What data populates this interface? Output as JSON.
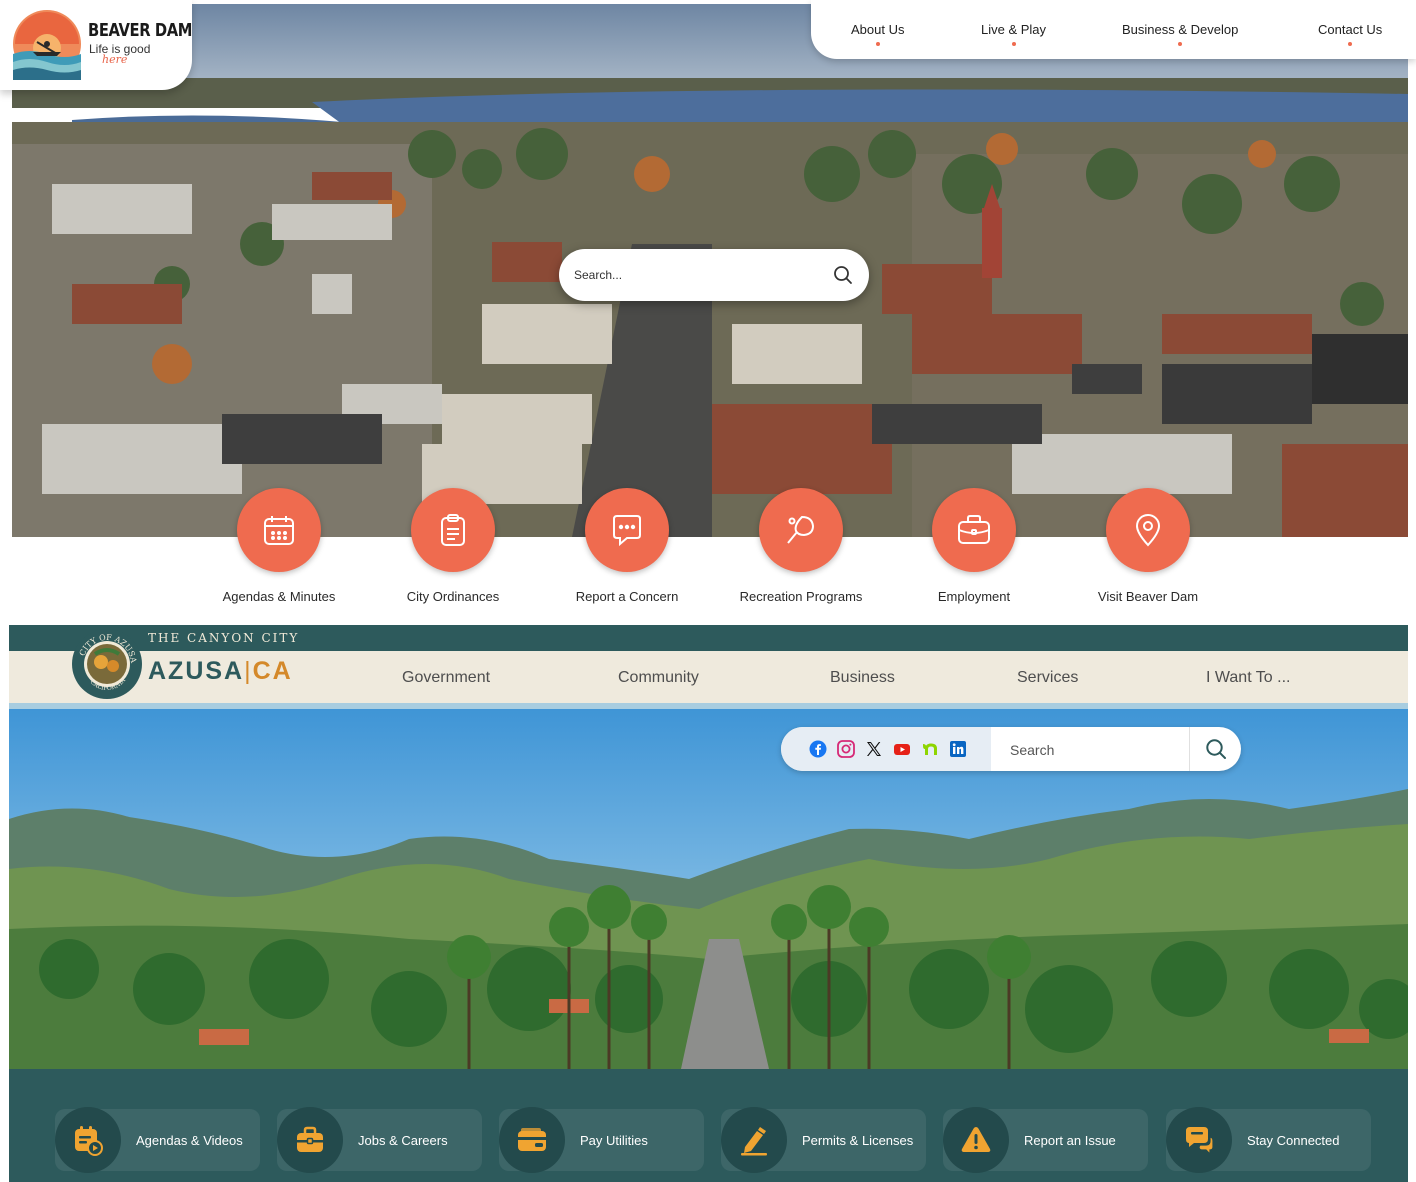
{
  "beaver_dam": {
    "logo": {
      "name": "BEAVER DAM",
      "tagline": "Life is good",
      "tagline_script": "here"
    },
    "nav": [
      {
        "label": "About Us"
      },
      {
        "label": "Live & Play"
      },
      {
        "label": "Business & Develop"
      },
      {
        "label": "Contact Us"
      }
    ],
    "search": {
      "placeholder": "Search..."
    },
    "quick_links": [
      {
        "label": "Agendas & Minutes",
        "icon": "calendar-icon"
      },
      {
        "label": "City Ordinances",
        "icon": "clipboard-icon"
      },
      {
        "label": "Report a Concern",
        "icon": "chat-bubble-icon"
      },
      {
        "label": "Recreation Programs",
        "icon": "paddle-ball-icon"
      },
      {
        "label": "Employment",
        "icon": "briefcase-icon"
      },
      {
        "label": "Visit Beaver Dam",
        "icon": "map-pin-icon"
      }
    ],
    "accent_color": "#ef6b4f"
  },
  "azusa": {
    "tagline": "THE CANYON CITY",
    "seal_text": "CITY OF AZUSA CALIFORNIA",
    "wordmark": {
      "city": "AZUSA",
      "separator": "|",
      "state": "CA"
    },
    "nav": [
      {
        "label": "Government"
      },
      {
        "label": "Community"
      },
      {
        "label": "Business"
      },
      {
        "label": "Services"
      },
      {
        "label": "I Want To ..."
      }
    ],
    "social": [
      {
        "name": "facebook-icon"
      },
      {
        "name": "instagram-icon"
      },
      {
        "name": "x-icon"
      },
      {
        "name": "youtube-icon"
      },
      {
        "name": "nextdoor-icon"
      },
      {
        "name": "linkedin-icon"
      }
    ],
    "search": {
      "placeholder": "Search"
    },
    "quick_links": [
      {
        "label": "Agendas & Videos",
        "icon": "calendar-play-icon"
      },
      {
        "label": "Jobs & Careers",
        "icon": "briefcase-icon"
      },
      {
        "label": "Pay Utilities",
        "icon": "wallet-icon"
      },
      {
        "label": "Permits & Licenses",
        "icon": "pencil-icon"
      },
      {
        "label": "Report an Issue",
        "icon": "warning-icon"
      },
      {
        "label": "Stay Connected",
        "icon": "chat-bubbles-icon"
      }
    ],
    "colors": {
      "primary": "#2d5a5c",
      "accent": "#d4892a",
      "nav_bg": "#efeadd"
    }
  }
}
